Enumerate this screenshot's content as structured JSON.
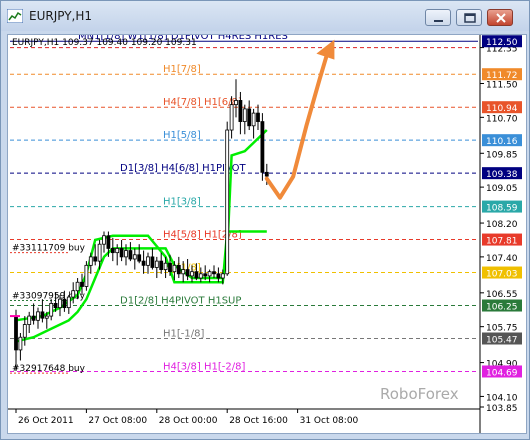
{
  "window": {
    "title": "EURJPY,H1",
    "buttons": [
      "minimize",
      "restore",
      "close"
    ]
  },
  "chart_data": {
    "type": "candlestick",
    "symbol_line": "EURJPY,H1  109.37 109.40 109.20 109.31",
    "watermark": "RoboForex",
    "ylim": [
      103.85,
      112.6
    ],
    "y_ticks": [
      "112.35",
      "111.50",
      "110.70",
      "109.85",
      "109.05",
      "108.20",
      "107.40",
      "106.55",
      "105.75",
      "104.90",
      "104.10",
      "103.85"
    ],
    "x_ticks": [
      "26 Oct 2011",
      "27 Oct 08:00",
      "28 Oct 00:00",
      "28 Oct 16:00",
      "31 Oct 08:00"
    ],
    "x_tick_index": [
      0,
      16,
      32,
      48,
      64
    ],
    "current_price_badge": {
      "value": "109.38",
      "color": "#000080"
    },
    "levels": [
      {
        "value": 112.5,
        "label": "MN1[1/8] W1[1/8] D1PIVOT H4RES H1RES",
        "color": "#000080",
        "style": "solid",
        "badge": "112.50",
        "badge_color": "#000080"
      },
      {
        "value": 112.35,
        "label": "",
        "color": "#dd2222",
        "style": "dashed",
        "badge": "",
        "badge_color": ""
      },
      {
        "value": 111.72,
        "label": "H1[7/8]",
        "color": "#f08a2a",
        "style": "dashed",
        "badge": "111.72",
        "badge_color": "#f08a2a"
      },
      {
        "value": 110.94,
        "label": "H4[7/8] H1[6/8]",
        "color": "#e8542a",
        "style": "dashed",
        "badge": "110.94",
        "badge_color": "#e8542a"
      },
      {
        "value": 110.16,
        "label": "H1[5/8]",
        "color": "#3a8fd8",
        "style": "dashed",
        "badge": "110.16",
        "badge_color": "#3a8fd8"
      },
      {
        "value": 109.38,
        "label": "D1[3/8] H4[6/8] H1PIVOT",
        "color": "#000080",
        "style": "dashed",
        "badge": "",
        "badge_color": ""
      },
      {
        "value": 108.59,
        "label": "H1[3/8]",
        "color": "#2aa8a8",
        "style": "dashed",
        "badge": "108.59",
        "badge_color": "#2aa8a8"
      },
      {
        "value": 107.81,
        "label": "H4[5/8] H1[2/8]",
        "color": "#e83a2a",
        "style": "dashed",
        "badge": "107.81",
        "badge_color": "#e83a2a"
      },
      {
        "value": 107.03,
        "label": "H1[1/8]",
        "color": "#f0c000",
        "style": "dashed",
        "badge": "107.03",
        "badge_color": "#f0c000"
      },
      {
        "value": 106.25,
        "label": "D1[2/8] H4PIVOT H1SUP",
        "color": "#2a7a3a",
        "style": "dashed",
        "badge": "106.25",
        "badge_color": "#2a7a3a"
      },
      {
        "value": 105.47,
        "label": "H1[-1/8]",
        "color": "#777777",
        "style": "dashed",
        "badge": "105.47",
        "badge_color": "#555555"
      },
      {
        "value": 104.69,
        "label": "H4[3/8] H1[-2/8]",
        "color": "#e020e0",
        "style": "dashed",
        "badge": "104.69",
        "badge_color": "#e020e0"
      }
    ],
    "orders": [
      {
        "label": "#33111709 buy",
        "value": 107.5,
        "color": "#e83a2a"
      },
      {
        "label": "#33097959 buy",
        "value": 106.37,
        "color": "#2a7a3a"
      },
      {
        "label": "#32917648 buy",
        "value": 104.65,
        "color": "#e83a2a"
      }
    ],
    "candles_ohlc": [
      [
        106.0,
        106.15,
        104.7,
        105.2
      ],
      [
        105.2,
        105.6,
        104.95,
        105.5
      ],
      [
        105.5,
        106.0,
        105.3,
        105.8
      ],
      [
        105.8,
        106.1,
        105.6,
        106.0
      ],
      [
        106.0,
        106.3,
        105.8,
        105.9
      ],
      [
        105.9,
        106.2,
        105.7,
        106.1
      ],
      [
        106.1,
        106.4,
        105.85,
        105.95
      ],
      [
        105.95,
        106.1,
        105.7,
        106.0
      ],
      [
        106.0,
        106.4,
        105.9,
        106.3
      ],
      [
        106.3,
        106.55,
        106.1,
        106.2
      ],
      [
        106.2,
        106.5,
        106.0,
        106.4
      ],
      [
        106.4,
        106.6,
        106.1,
        106.2
      ],
      [
        106.2,
        106.5,
        106.05,
        106.45
      ],
      [
        106.45,
        106.8,
        106.3,
        106.6
      ],
      [
        106.6,
        106.9,
        106.4,
        106.8
      ],
      [
        106.8,
        107.0,
        106.5,
        106.7
      ],
      [
        106.7,
        107.3,
        106.6,
        107.2
      ],
      [
        107.2,
        107.5,
        107.0,
        107.4
      ],
      [
        107.4,
        107.7,
        107.2,
        107.3
      ],
      [
        107.3,
        107.8,
        107.1,
        107.7
      ],
      [
        107.7,
        108.0,
        107.5,
        107.9
      ],
      [
        107.9,
        108.0,
        107.4,
        107.6
      ],
      [
        107.6,
        107.85,
        107.3,
        107.5
      ],
      [
        107.5,
        107.7,
        107.2,
        107.6
      ],
      [
        107.6,
        107.8,
        107.3,
        107.4
      ],
      [
        107.4,
        107.7,
        107.2,
        107.55
      ],
      [
        107.55,
        107.75,
        107.3,
        107.35
      ],
      [
        107.35,
        107.6,
        107.1,
        107.45
      ],
      [
        107.45,
        107.7,
        107.25,
        107.3
      ],
      [
        107.3,
        107.55,
        107.0,
        107.2
      ],
      [
        107.2,
        107.5,
        107.0,
        107.4
      ],
      [
        107.4,
        107.6,
        107.1,
        107.15
      ],
      [
        107.15,
        107.4,
        106.9,
        107.3
      ],
      [
        107.3,
        107.5,
        107.0,
        107.1
      ],
      [
        107.1,
        107.4,
        106.9,
        107.25
      ],
      [
        107.25,
        107.45,
        106.95,
        107.05
      ],
      [
        107.05,
        107.3,
        106.85,
        107.2
      ],
      [
        107.2,
        107.4,
        106.9,
        107.0
      ],
      [
        107.0,
        107.3,
        106.8,
        107.1
      ],
      [
        107.1,
        107.35,
        106.85,
        106.95
      ],
      [
        106.95,
        107.2,
        106.8,
        107.05
      ],
      [
        107.05,
        107.25,
        106.85,
        106.9
      ],
      [
        106.9,
        107.15,
        106.8,
        107.0
      ],
      [
        107.0,
        107.2,
        106.85,
        106.95
      ],
      [
        106.95,
        107.1,
        106.8,
        107.05
      ],
      [
        107.05,
        107.2,
        106.9,
        107.0
      ],
      [
        107.0,
        107.15,
        106.8,
        106.9
      ],
      [
        106.9,
        107.1,
        106.75,
        107.0
      ],
      [
        107.0,
        110.6,
        106.95,
        110.4
      ],
      [
        110.4,
        111.2,
        110.2,
        111.0
      ],
      [
        111.0,
        111.6,
        110.7,
        111.1
      ],
      [
        111.1,
        111.3,
        110.3,
        110.6
      ],
      [
        110.6,
        111.0,
        110.3,
        110.9
      ],
      [
        110.9,
        111.1,
        110.4,
        110.5
      ],
      [
        110.5,
        110.9,
        110.2,
        110.8
      ],
      [
        110.8,
        111.0,
        110.4,
        110.6
      ],
      [
        110.6,
        110.8,
        109.2,
        109.4
      ],
      [
        109.4,
        109.6,
        109.1,
        109.31
      ]
    ],
    "green_lines": [
      {
        "name": "",
        "points": [
          [
            0,
            105.4
          ],
          [
            4,
            105.5
          ],
          [
            8,
            105.7
          ],
          [
            12,
            105.9
          ],
          [
            14,
            106.1
          ],
          [
            16,
            106.4
          ],
          [
            18,
            106.9
          ],
          [
            20,
            107.4
          ],
          [
            22,
            107.6
          ],
          [
            30,
            107.6
          ],
          [
            34,
            107.6
          ],
          [
            36,
            107.2
          ],
          [
            40,
            106.9
          ],
          [
            47,
            106.9
          ],
          [
            48,
            107.5
          ],
          [
            49,
            109.8
          ],
          [
            52,
            109.9
          ],
          [
            54,
            110.1
          ],
          [
            57,
            110.4
          ]
        ]
      },
      {
        "name": "",
        "points": [
          [
            0,
            105.9
          ],
          [
            6,
            106.0
          ],
          [
            10,
            106.2
          ],
          [
            14,
            106.5
          ],
          [
            16,
            107.0
          ],
          [
            18,
            107.8
          ],
          [
            22,
            107.9
          ],
          [
            30,
            107.9
          ],
          [
            34,
            107.4
          ],
          [
            36,
            106.8
          ],
          [
            47,
            106.8
          ],
          [
            48,
            108.0
          ],
          [
            57,
            108.0
          ]
        ]
      }
    ],
    "arrow_path": [
      [
        57,
        109.25
      ],
      [
        60,
        108.8
      ],
      [
        63,
        109.3
      ],
      [
        66,
        110.5
      ],
      [
        69,
        111.6
      ],
      [
        71,
        112.3
      ]
    ],
    "grid": false,
    "legend": "none"
  }
}
